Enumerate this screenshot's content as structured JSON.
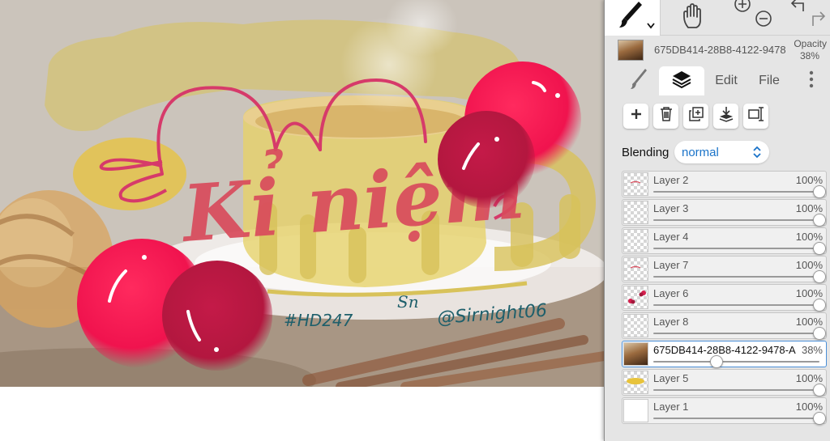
{
  "canvas": {
    "artwork_text": {
      "title_main": "Kỉ niệm",
      "tag_hashtag": "#HD247",
      "tag_handle": "@Sirnight06",
      "signature": "Sn"
    }
  },
  "toolbar": {
    "tools": [
      {
        "name": "brush",
        "icon": "brush-icon",
        "active": true
      },
      {
        "name": "hand",
        "icon": "hand-icon"
      },
      {
        "name": "zoom",
        "icons": [
          "zoom-in-icon",
          "zoom-out-icon"
        ]
      },
      {
        "name": "undo-redo",
        "icons": [
          "undo-icon",
          "redo-icon"
        ]
      }
    ]
  },
  "document": {
    "name": "675DB414-28B8-4122-9478",
    "opacity_label": "Opacity",
    "opacity_value": "38%"
  },
  "tabs": [
    {
      "label": "",
      "icon": "brush-icon"
    },
    {
      "label": "",
      "icon": "layers-icon",
      "active": true
    },
    {
      "label": "Edit"
    },
    {
      "label": "File"
    },
    {
      "label": "",
      "icon": "more-vertical-icon"
    }
  ],
  "layer_actions": [
    "add-layer-icon",
    "delete-layer-icon",
    "duplicate-layer-icon",
    "merge-down-icon",
    "transform-icon"
  ],
  "blending": {
    "label": "Blending",
    "value": "normal"
  },
  "layers": [
    {
      "name": "Layer 2",
      "opacity": "100%",
      "level": 1.0,
      "thumb": "sketch-red",
      "selected": false
    },
    {
      "name": "Layer 3",
      "opacity": "100%",
      "level": 1.0,
      "thumb": "empty",
      "selected": false
    },
    {
      "name": "Layer 4",
      "opacity": "100%",
      "level": 1.0,
      "thumb": "empty",
      "selected": false
    },
    {
      "name": "Layer 7",
      "opacity": "100%",
      "level": 1.0,
      "thumb": "sketch-red",
      "selected": false
    },
    {
      "name": "Layer 6",
      "opacity": "100%",
      "level": 1.0,
      "thumb": "red-dots",
      "selected": false
    },
    {
      "name": "Layer 8",
      "opacity": "100%",
      "level": 1.0,
      "thumb": "empty",
      "selected": false
    },
    {
      "name": "675DB414-28B8-4122-9478-A",
      "opacity": "38%",
      "level": 0.38,
      "thumb": "photo",
      "selected": true
    },
    {
      "name": "Layer 5",
      "opacity": "100%",
      "level": 1.0,
      "thumb": "yellow",
      "selected": false
    },
    {
      "name": "Layer 1",
      "opacity": "100%",
      "level": 1.0,
      "thumb": "white",
      "selected": false
    }
  ],
  "colors": {
    "accent_blue": "#1a73c9",
    "selection_border": "#4a8fd8",
    "panel_bg": "#e5e5e5",
    "cherry_red": "#f0134e",
    "title_red": "#d94b5c",
    "overlay_yellow": "#d8c25a"
  }
}
